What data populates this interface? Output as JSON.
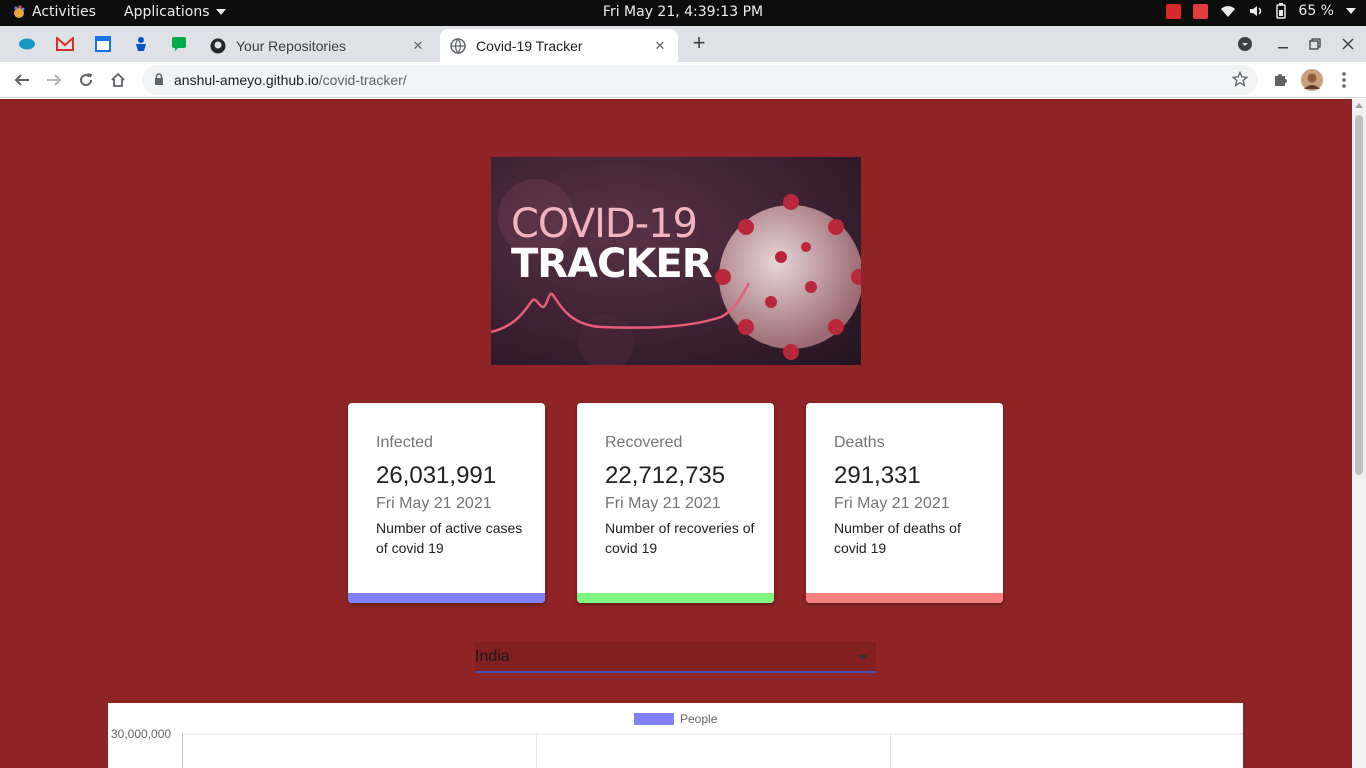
{
  "topbar": {
    "activities_label": "Activities",
    "applications_label": "Applications",
    "clock": "Fri May 21,  4:39:13 PM",
    "battery": "65 %"
  },
  "tabs": [
    {
      "title": "Your Repositories",
      "icon": "github-icon",
      "active": false
    },
    {
      "title": "Covid-19 Tracker",
      "icon": "globe-icon",
      "active": true
    }
  ],
  "pinned_tabs": [
    "salesforce-icon",
    "gmail-icon",
    "calendar-icon",
    "jira-icon",
    "chat-icon"
  ],
  "omnibox": {
    "host": "anshul-ameyo.github.io",
    "path": "/covid-tracker/"
  },
  "page": {
    "banner": {
      "line1": "COVID-19",
      "line2": "TRACKER"
    },
    "cards": [
      {
        "label": "Infected",
        "value": "26,031,991",
        "date": "Fri May 21 2021",
        "desc": "Number of active cases of covid 19",
        "color": "#7f7ff7"
      },
      {
        "label": "Recovered",
        "value": "22,712,735",
        "date": "Fri May 21 2021",
        "desc": "Number of recoveries of covid 19",
        "color": "#7ff77f"
      },
      {
        "label": "Deaths",
        "value": "291,331",
        "date": "Fri May 21 2021",
        "desc": "Number of deaths of covid 19",
        "color": "#f77f7f"
      }
    ],
    "country_select": {
      "value": "India"
    },
    "chart": {
      "legend": "People",
      "legend_color": "#8080f8",
      "ytick_top": "30,000,000"
    }
  },
  "colors": {
    "page_bg": "#8e2425",
    "select_underline": "#3f51b5"
  }
}
